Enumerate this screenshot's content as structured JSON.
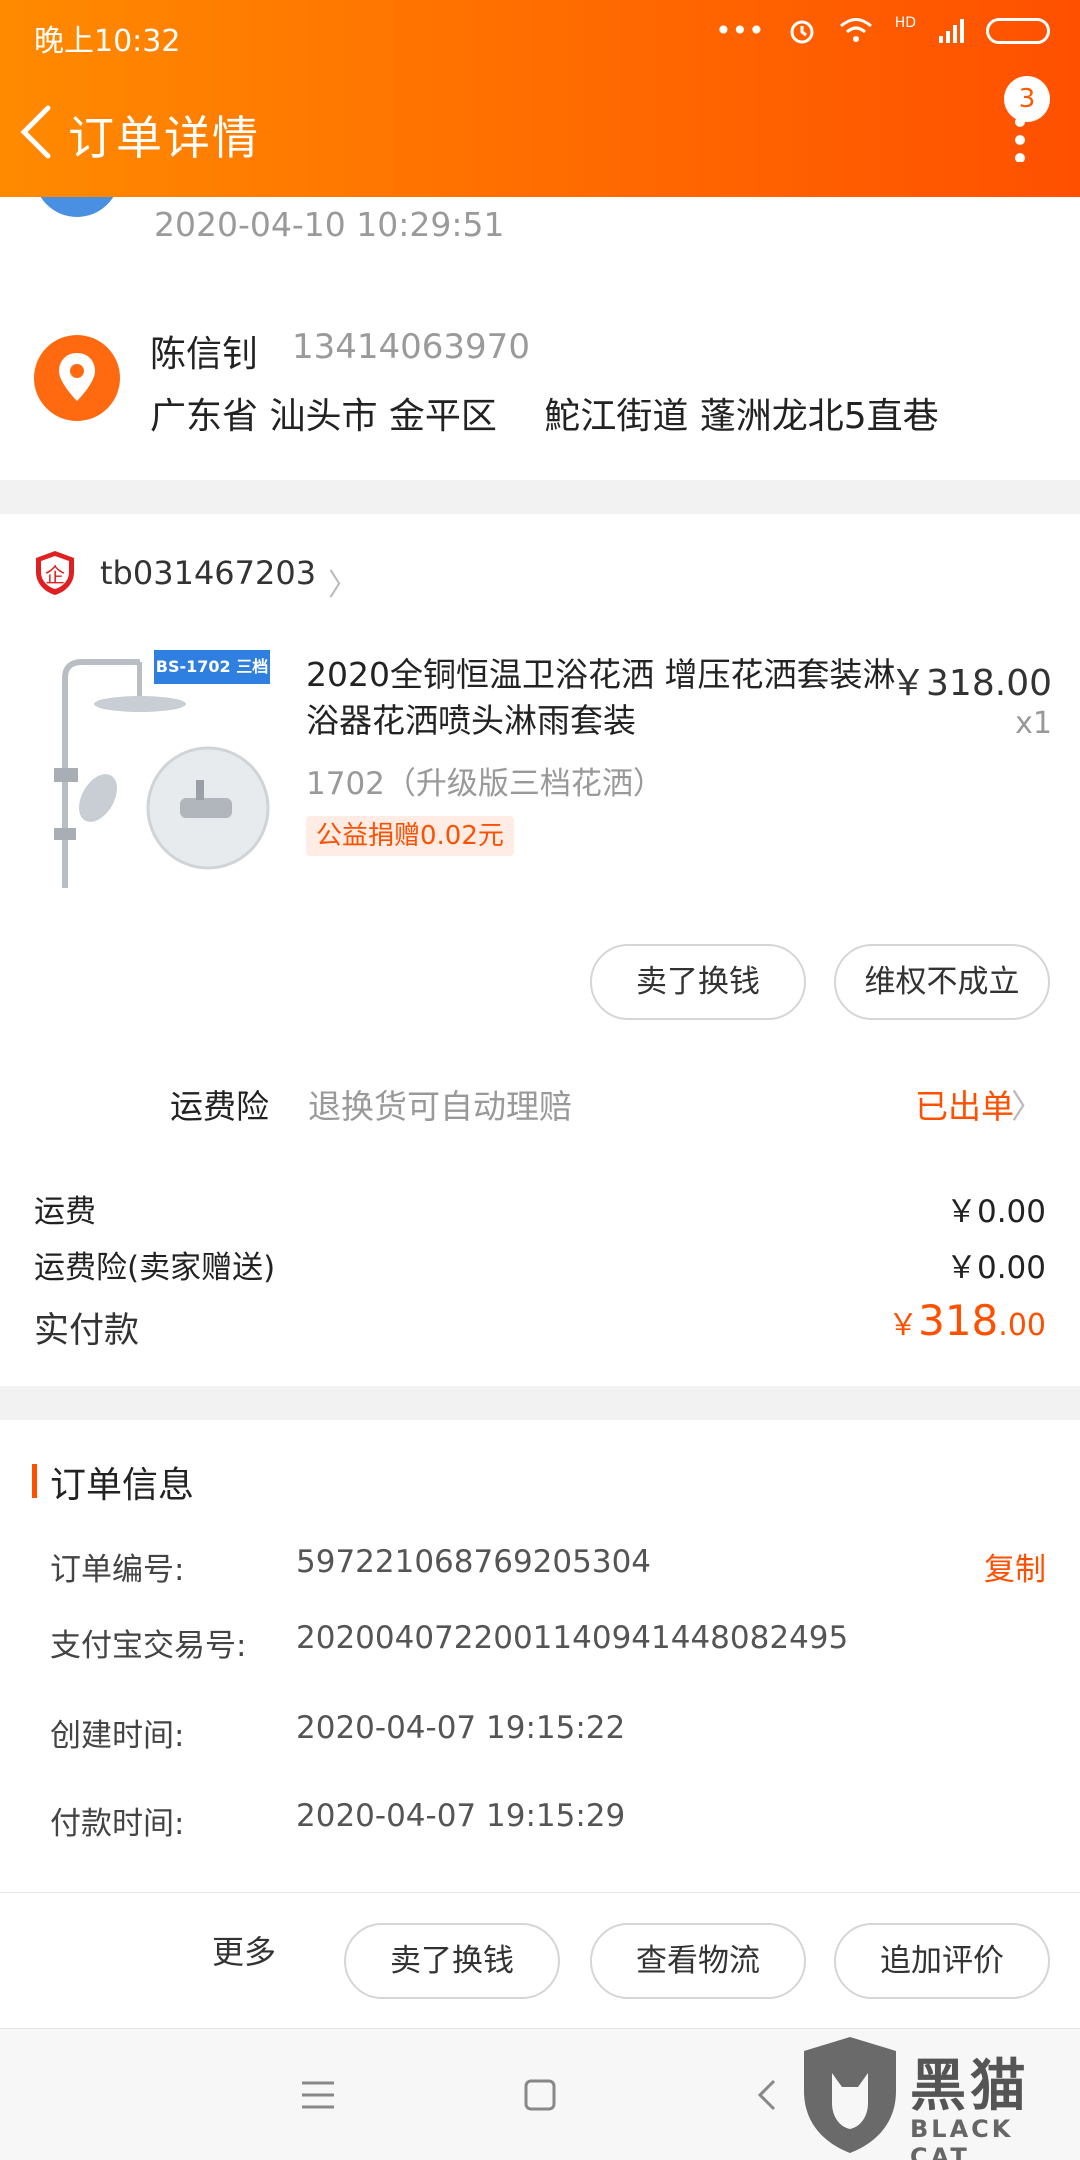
{
  "status_bar": {
    "time": "晚上10:32",
    "network": "HD"
  },
  "header": {
    "title": "订单详情",
    "badge_count": "3"
  },
  "logistics": {
    "time": "2020-04-10 10:29:51"
  },
  "address": {
    "name": "陈信钊",
    "phone": "13414063970",
    "line": "广东省 汕头市 金平区　 鮀江街道 蓬洲龙北5直巷"
  },
  "shop": {
    "name": "tb031467203",
    "icon": "enterprise-shop-icon"
  },
  "product": {
    "model_tag": "BS-1702 三档",
    "title": "2020全铜恒温卫浴花洒 增压花洒套装淋浴器花洒喷头淋雨套装",
    "price": "￥318.00",
    "quantity": "x1",
    "spec": "1702（升级版三档花洒）",
    "charity": "公益捐赠0.02元"
  },
  "item_actions": {
    "sell": "卖了换钱",
    "dispute": "维权不成立"
  },
  "insurance": {
    "label": "运费险",
    "desc": "退换货可自动理赔",
    "status": "已出单"
  },
  "fees": [
    {
      "label": "运费",
      "value": "￥0.00"
    },
    {
      "label": "运费险(卖家赠送)",
      "value": "￥0.00"
    }
  ],
  "paid": {
    "label": "实付款",
    "currency": "￥",
    "integer": "318",
    "decimal": ".00"
  },
  "order_info": {
    "title": "订单信息",
    "copy": "复制",
    "rows": [
      {
        "label": "订单编号:",
        "value": "597221068769205304"
      },
      {
        "label": "支付宝交易号:",
        "value": "2020040722001140941448082495"
      },
      {
        "label": "创建时间:",
        "value": "2020-04-07 19:15:22"
      },
      {
        "label": "付款时间:",
        "value": "2020-04-07 19:15:29"
      }
    ]
  },
  "bottom_actions": {
    "more": "更多",
    "sell": "卖了换钱",
    "logistics": "查看物流",
    "review": "追加评价"
  },
  "watermark": {
    "title": "黑猫",
    "subtitle": "BLACK CAT"
  },
  "colors": {
    "accent": "#ff5000",
    "header_start": "#ff8a00",
    "header_end": "#ff5000"
  }
}
